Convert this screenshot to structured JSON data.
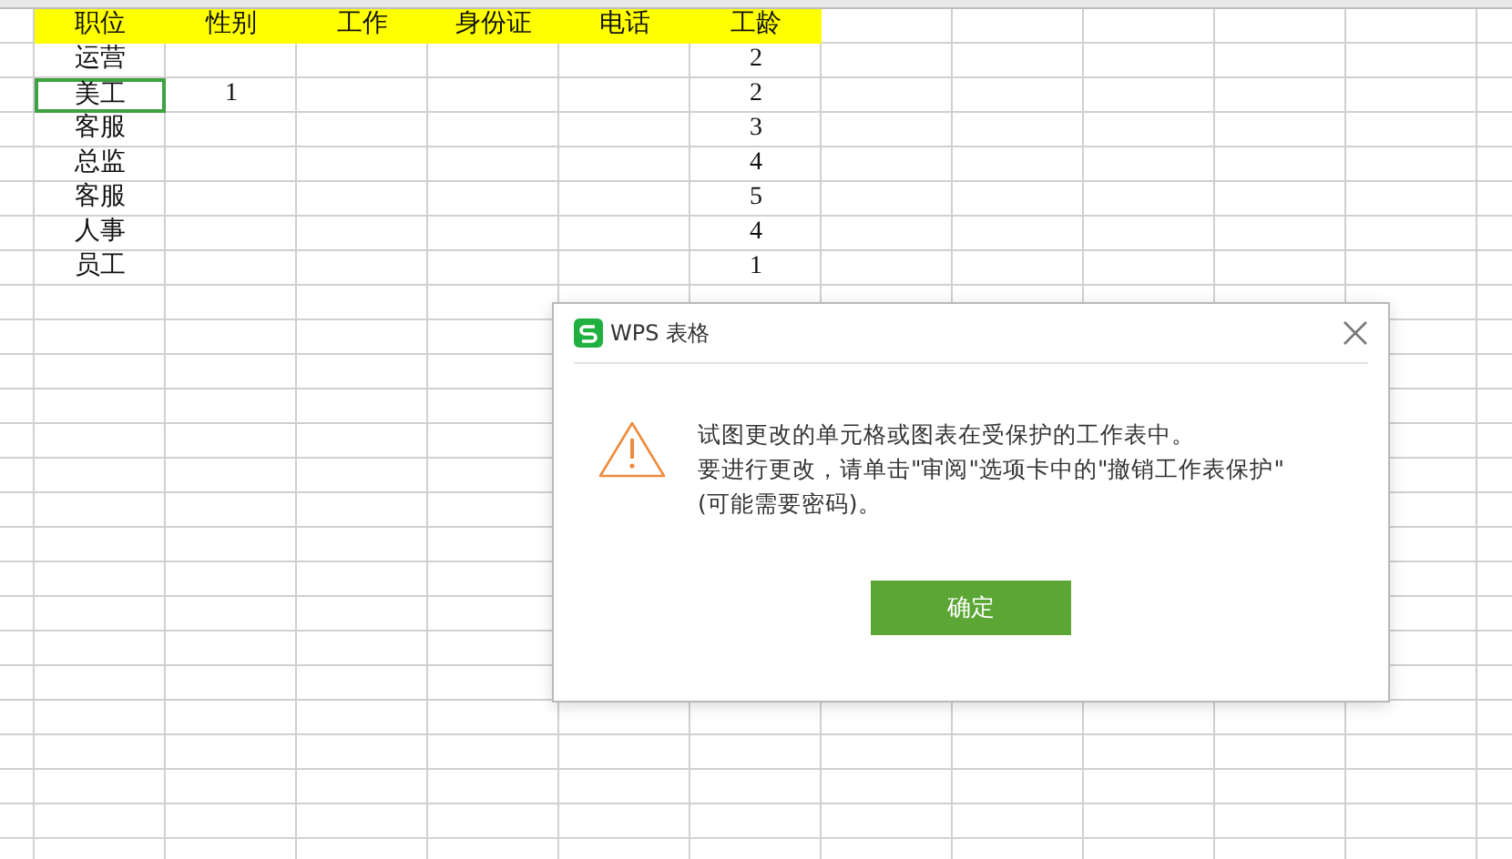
{
  "sheet": {
    "headers": [
      "职位",
      "性别",
      "工作",
      "身份证",
      "电话",
      "工龄"
    ],
    "rows": [
      {
        "position": "运营",
        "gender": null,
        "years": "2",
        "selected": false
      },
      {
        "position": "美工",
        "gender": "1",
        "years": "2",
        "selected": true
      },
      {
        "position": "客服",
        "gender": null,
        "years": "3",
        "selected": false
      },
      {
        "position": "总监",
        "gender": null,
        "years": "4",
        "selected": false
      },
      {
        "position": "客服",
        "gender": null,
        "years": "5",
        "selected": false
      },
      {
        "position": "人事",
        "gender": null,
        "years": "4",
        "selected": false
      },
      {
        "position": "员工",
        "gender": null,
        "years": "1",
        "selected": false
      }
    ]
  },
  "dialog": {
    "title": "WPS 表格",
    "message": [
      "试图更改的单元格或图表在受保护的工作表中。",
      "要进行更改，请单击\"审阅\"选项卡中的\"撤销工作表保护\"(可能需要密码)。"
    ],
    "button": "确定"
  }
}
